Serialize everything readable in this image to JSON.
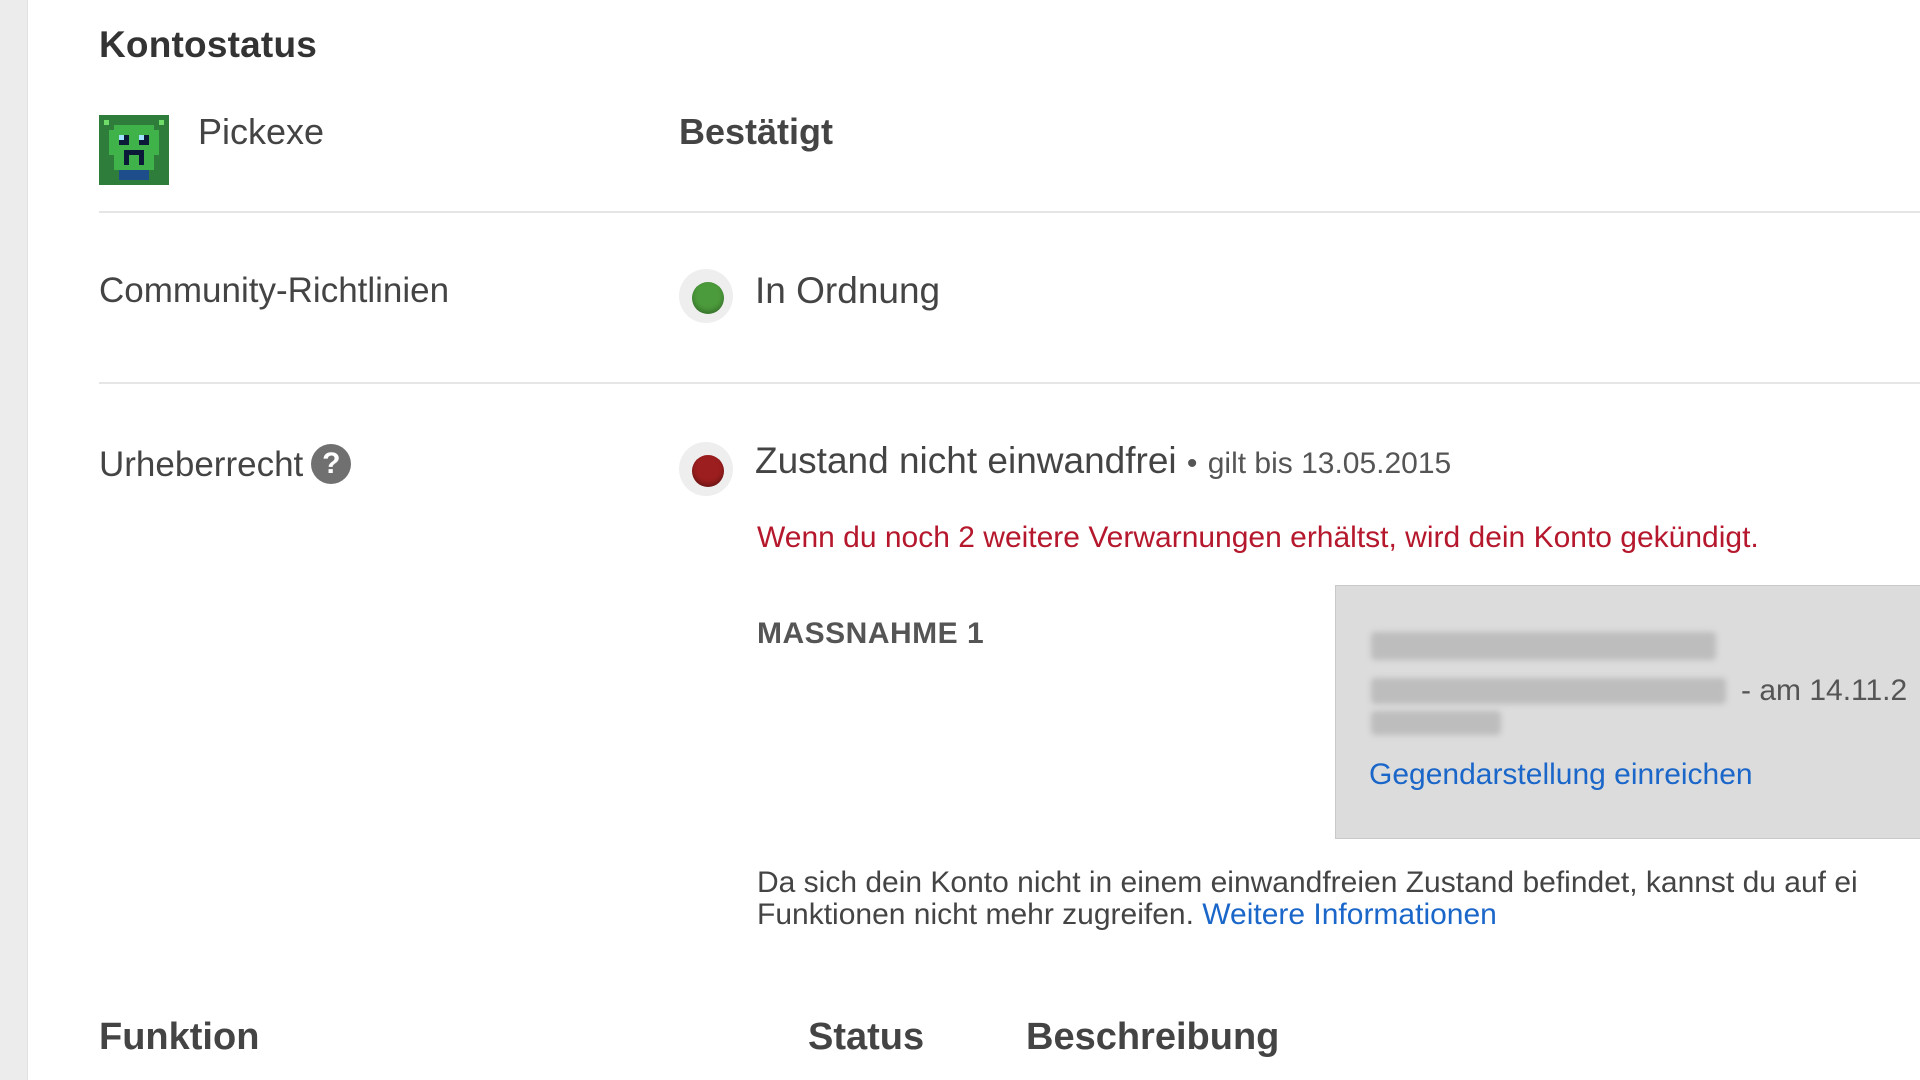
{
  "section_title": "Kontostatus",
  "channel": {
    "name": "Pickexe",
    "verification_status": "Bestätigt",
    "avatar_icon": "pixel-alien-avatar"
  },
  "community": {
    "label": "Community-Richtlinien",
    "status_color": "#4b9a3b",
    "status_text": "In Ordnung"
  },
  "copyright": {
    "label": "Urheberrecht",
    "help_icon": "?",
    "status_color": "#9c1e1e",
    "status_text": "Zustand nicht einwandfrei",
    "status_separator": "•",
    "valid_until": "gilt bis 13.05.2015",
    "warning": "Wenn du noch 2 weitere Verwarnungen erhältst, wird dein Konto gekündigt.",
    "measure_label": "MASSNAHME 1",
    "strike": {
      "date_text": "- am 14.11.2",
      "counter_notice_link": "Gegendarstellung einreichen"
    },
    "info_line1": "Da sich dein Konto nicht in einem einwandfreien Zustand befindet, kannst du auf ei",
    "info_line2": "Funktionen nicht mehr zugreifen.",
    "info_link": "Weitere Informationen"
  },
  "features_table": {
    "headers": [
      "Funktion",
      "Status",
      "Beschreibung"
    ]
  },
  "colors": {
    "link": "#1a66c9",
    "warning": "#b5172c"
  }
}
